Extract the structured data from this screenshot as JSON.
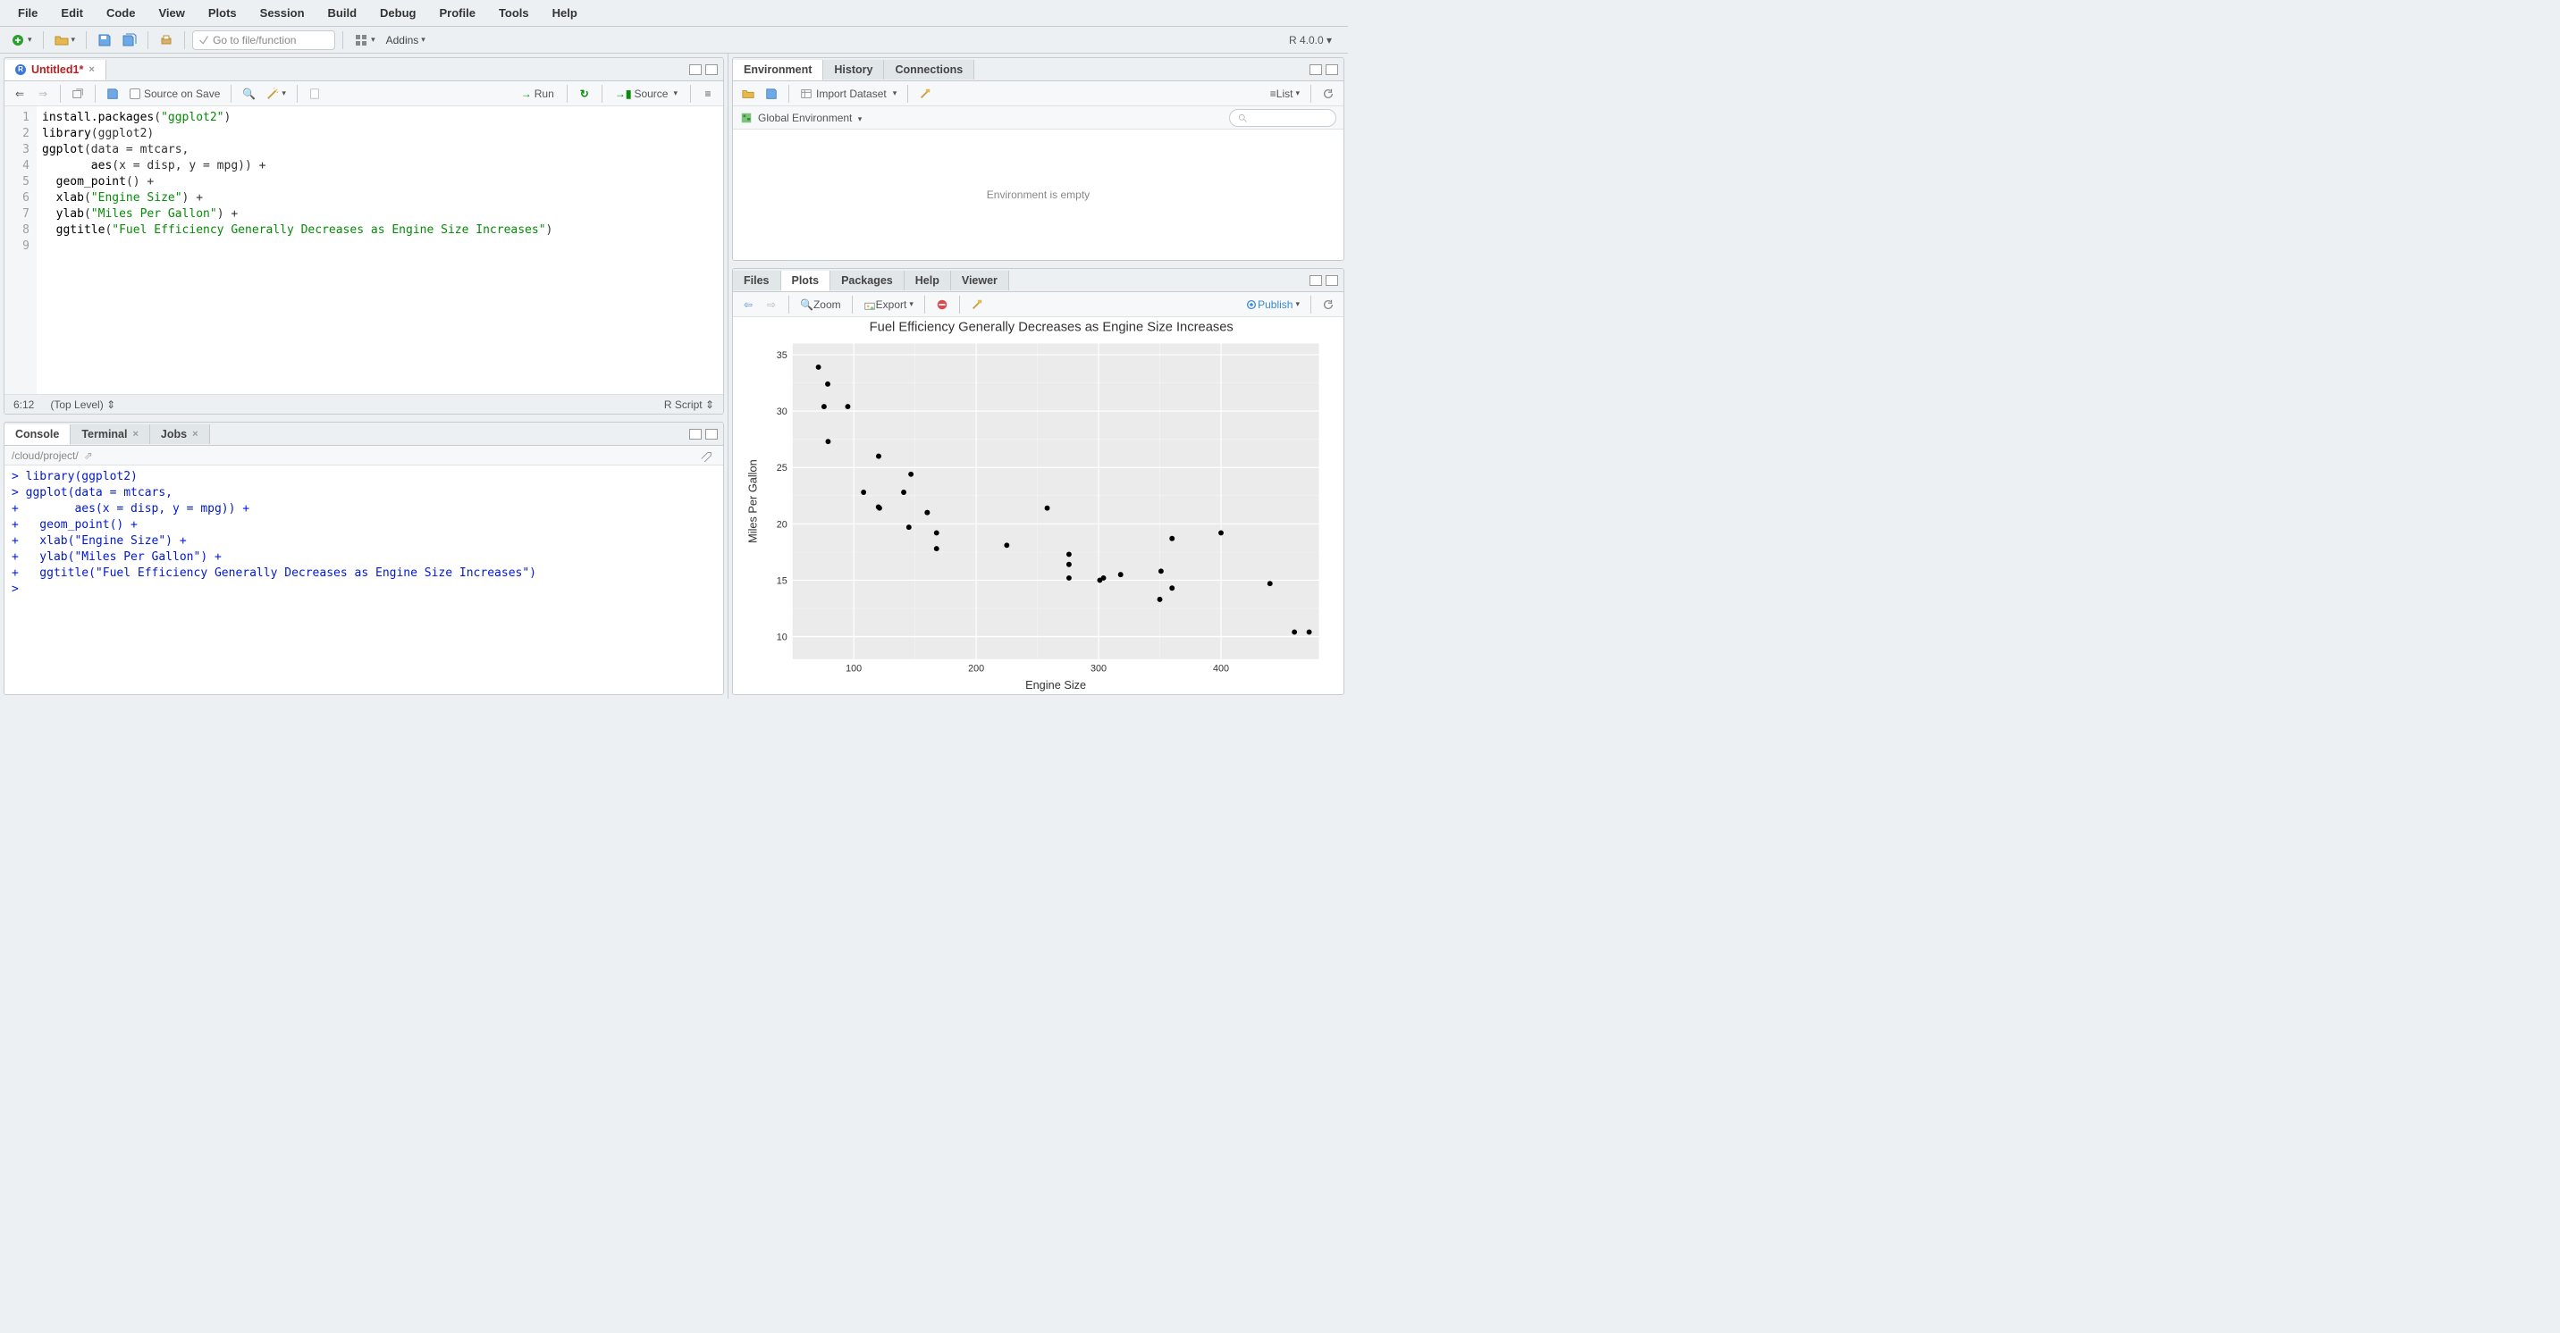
{
  "menu": [
    "File",
    "Edit",
    "Code",
    "View",
    "Plots",
    "Session",
    "Build",
    "Debug",
    "Profile",
    "Tools",
    "Help"
  ],
  "toolbar": {
    "goto_placeholder": "Go to file/function",
    "addins_label": "Addins",
    "r_version": "R 4.0.0"
  },
  "source": {
    "tab_name": "Untitled1*",
    "source_on_save": "Source on Save",
    "run_label": "Run",
    "source_label": "Source",
    "cursor_pos": "6:12",
    "scope": "(Top Level)",
    "lang": "R Script",
    "code_lines": [
      {
        "n": 1,
        "segments": [
          {
            "t": "fn",
            "v": "install.packages"
          },
          {
            "t": "op",
            "v": "("
          },
          {
            "t": "str",
            "v": "\"ggplot2\""
          },
          {
            "t": "op",
            "v": ")"
          }
        ]
      },
      {
        "n": 2,
        "segments": [
          {
            "t": "fn",
            "v": "library"
          },
          {
            "t": "op",
            "v": "("
          },
          {
            "t": "arg",
            "v": "ggplot2"
          },
          {
            "t": "op",
            "v": ")"
          }
        ]
      },
      {
        "n": 3,
        "segments": [
          {
            "t": "fn",
            "v": "ggplot"
          },
          {
            "t": "op",
            "v": "("
          },
          {
            "t": "arg",
            "v": "data = mtcars,"
          }
        ]
      },
      {
        "n": 4,
        "segments": [
          {
            "t": "arg",
            "v": "       "
          },
          {
            "t": "fn",
            "v": "aes"
          },
          {
            "t": "op",
            "v": "("
          },
          {
            "t": "arg",
            "v": "x = disp, y = mpg"
          },
          {
            "t": "op",
            "v": ")) +"
          }
        ]
      },
      {
        "n": 5,
        "segments": [
          {
            "t": "arg",
            "v": "  "
          },
          {
            "t": "fn",
            "v": "geom_point"
          },
          {
            "t": "op",
            "v": "() +"
          }
        ]
      },
      {
        "n": 6,
        "segments": [
          {
            "t": "arg",
            "v": "  "
          },
          {
            "t": "fn",
            "v": "xlab"
          },
          {
            "t": "op",
            "v": "("
          },
          {
            "t": "str",
            "v": "\"Engine Size\""
          },
          {
            "t": "op",
            "v": ") +"
          }
        ]
      },
      {
        "n": 7,
        "segments": [
          {
            "t": "arg",
            "v": "  "
          },
          {
            "t": "fn",
            "v": "ylab"
          },
          {
            "t": "op",
            "v": "("
          },
          {
            "t": "str",
            "v": "\"Miles Per Gallon\""
          },
          {
            "t": "op",
            "v": ") +"
          }
        ]
      },
      {
        "n": 8,
        "segments": [
          {
            "t": "arg",
            "v": "  "
          },
          {
            "t": "fn",
            "v": "ggtitle"
          },
          {
            "t": "op",
            "v": "("
          },
          {
            "t": "str",
            "v": "\"Fuel Efficiency Generally Decreases as Engine Size Increases\""
          },
          {
            "t": "op",
            "v": ")"
          }
        ]
      },
      {
        "n": 9,
        "segments": [
          {
            "t": "arg",
            "v": ""
          }
        ]
      }
    ]
  },
  "console": {
    "tabs": [
      "Console",
      "Terminal",
      "Jobs"
    ],
    "path": "/cloud/project/",
    "lines": [
      "> library(ggplot2)",
      "> ggplot(data = mtcars,",
      "+        aes(x = disp, y = mpg)) +",
      "+   geom_point() +",
      "+   xlab(\"Engine Size\") +",
      "+   ylab(\"Miles Per Gallon\") +",
      "+   ggtitle(\"Fuel Efficiency Generally Decreases as Engine Size Increases\")",
      "> "
    ]
  },
  "env": {
    "tabs": [
      "Environment",
      "History",
      "Connections"
    ],
    "import_label": "Import Dataset",
    "list_label": "List",
    "scope": "Global Environment",
    "empty_msg": "Environment is empty"
  },
  "plots": {
    "tabs": [
      "Files",
      "Plots",
      "Packages",
      "Help",
      "Viewer"
    ],
    "zoom_label": "Zoom",
    "export_label": "Export",
    "publish_label": "Publish"
  },
  "chart_data": {
    "type": "scatter",
    "title": "Fuel Efficiency Generally Decreases as Engine Size Increases",
    "xlabel": "Engine Size",
    "ylabel": "Miles Per Gallon",
    "xlim": [
      50,
      480
    ],
    "ylim": [
      8,
      36
    ],
    "x_ticks": [
      100,
      200,
      300,
      400
    ],
    "y_ticks": [
      10,
      15,
      20,
      25,
      30,
      35
    ],
    "points": [
      {
        "x": 160,
        "y": 21.0
      },
      {
        "x": 160,
        "y": 21.0
      },
      {
        "x": 108,
        "y": 22.8
      },
      {
        "x": 258,
        "y": 21.4
      },
      {
        "x": 360,
        "y": 18.7
      },
      {
        "x": 225,
        "y": 18.1
      },
      {
        "x": 360,
        "y": 14.3
      },
      {
        "x": 146.7,
        "y": 24.4
      },
      {
        "x": 140.8,
        "y": 22.8
      },
      {
        "x": 167.6,
        "y": 19.2
      },
      {
        "x": 167.6,
        "y": 17.8
      },
      {
        "x": 275.8,
        "y": 16.4
      },
      {
        "x": 275.8,
        "y": 17.3
      },
      {
        "x": 275.8,
        "y": 15.2
      },
      {
        "x": 472,
        "y": 10.4
      },
      {
        "x": 460,
        "y": 10.4
      },
      {
        "x": 440,
        "y": 14.7
      },
      {
        "x": 78.7,
        "y": 32.4
      },
      {
        "x": 75.7,
        "y": 30.4
      },
      {
        "x": 71.1,
        "y": 33.9
      },
      {
        "x": 120.1,
        "y": 21.5
      },
      {
        "x": 318,
        "y": 15.5
      },
      {
        "x": 304,
        "y": 15.2
      },
      {
        "x": 350,
        "y": 13.3
      },
      {
        "x": 400,
        "y": 19.2
      },
      {
        "x": 79,
        "y": 27.3
      },
      {
        "x": 120.3,
        "y": 26.0
      },
      {
        "x": 95.1,
        "y": 30.4
      },
      {
        "x": 351,
        "y": 15.8
      },
      {
        "x": 145,
        "y": 19.7
      },
      {
        "x": 301,
        "y": 15.0
      },
      {
        "x": 121,
        "y": 21.4
      }
    ]
  }
}
